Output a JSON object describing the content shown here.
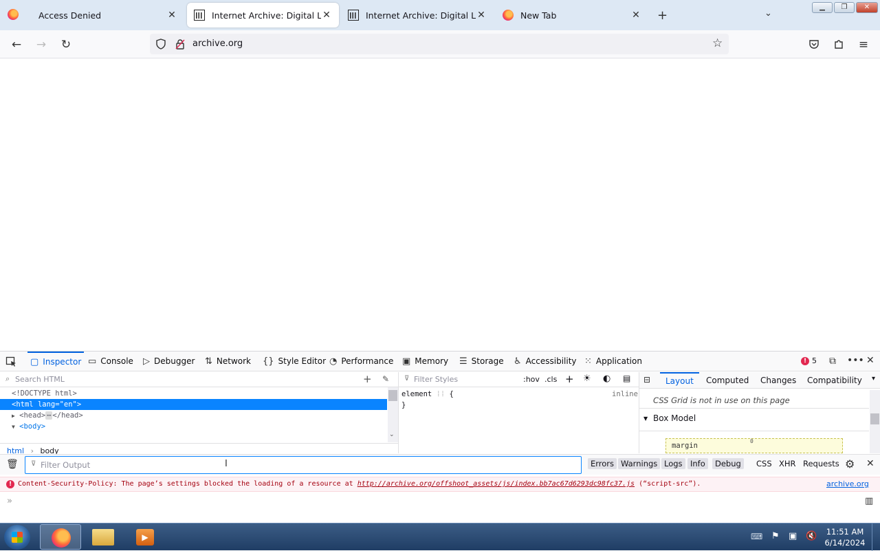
{
  "tabs": [
    {
      "title": "Access Denied",
      "favicon": "firefox-icon"
    },
    {
      "title": "Internet Archive: Digital Library",
      "favicon": "archive-icon"
    },
    {
      "title": "Internet Archive: Digital Library",
      "favicon": "archive-icon"
    },
    {
      "title": "New Tab",
      "favicon": "firefox-icon"
    }
  ],
  "navbar": {
    "url": "archive.org"
  },
  "devtools": {
    "tabs": [
      "Inspector",
      "Console",
      "Debugger",
      "Network",
      "Style Editor",
      "Performance",
      "Memory",
      "Storage",
      "Accessibility",
      "Application"
    ],
    "error_count": "5",
    "search_html_placeholder": "Search HTML",
    "tree": {
      "doctype": "<!DOCTYPE html>",
      "html_tag": "<html",
      "html_attr": "lang",
      "html_val": "\"en\"",
      "html_end": ">",
      "head_open": "<head>",
      "head_close": "</head>",
      "body_open": "<body>"
    },
    "breadcrumbs": [
      "html",
      "body"
    ],
    "rules": {
      "filter_placeholder": "Filter Styles",
      "hov": ":hov",
      "cls": ".cls",
      "selector": "element",
      "brace_open": "{",
      "brace_close": "}",
      "source": "inline"
    },
    "layout": {
      "tabs": [
        "Layout",
        "Computed",
        "Changes",
        "Compatibility"
      ],
      "grid_message": "CSS Grid is not in use on this page",
      "box_model_title": "Box Model",
      "margin_label": "margin",
      "margin_value": "0"
    },
    "console": {
      "filter_placeholder": "Filter Output",
      "filters": [
        "Errors",
        "Warnings",
        "Logs",
        "Info",
        "Debug",
        "CSS",
        "XHR",
        "Requests"
      ],
      "error_prefix": "Content-Security-Policy: The page’s settings blocked the loading of a resource at ",
      "error_url": "http://archive.org/offshoot_assets/js/index.bb7ac67d6293dc98fc37.js",
      "error_suffix": " (“script-src”).",
      "error_source": "archive.org"
    }
  },
  "taskbar": {
    "time": "11:51 AM",
    "date": "6/14/2024"
  },
  "colors": {
    "accent": "#0061e0",
    "error": "#a4000f",
    "selection": "#0a84ff"
  }
}
